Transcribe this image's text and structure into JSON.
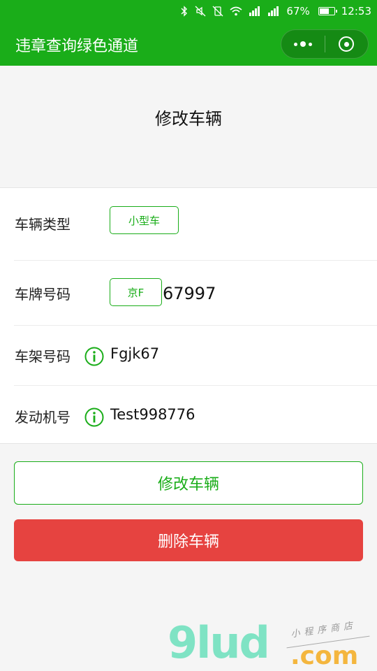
{
  "status_bar": {
    "battery_percent": "67%",
    "battery_level": 0.67,
    "time": "12:53",
    "icons": [
      "bluetooth-icon",
      "mute-icon",
      "vibrate-icon",
      "wifi-icon",
      "signal-icon",
      "signal-icon-2"
    ]
  },
  "nav": {
    "title": "违章查询绿色通道",
    "background_color": "#1aad19",
    "capsule_icons": [
      "more-dots-icon",
      "close-target-icon"
    ]
  },
  "page": {
    "heading": "修改车辆"
  },
  "form": {
    "vehicle_type": {
      "label": "车辆类型",
      "value": "小型车"
    },
    "plate": {
      "label": "车牌号码",
      "prefix": "京F",
      "number": "67997"
    },
    "frame": {
      "label": "车架号码",
      "value": "Fgjk67",
      "icon": "info-icon"
    },
    "engine": {
      "label": "发动机号",
      "value": "Test998776",
      "icon": "info-icon"
    }
  },
  "buttons": {
    "edit_label": "修改车辆",
    "delete_label": "删除车辆",
    "accent_color": "#1aad19",
    "danger_color": "#e64340"
  },
  "watermark": {
    "big": "9lud",
    "suffix": ".com",
    "cn": "小程序商店"
  }
}
